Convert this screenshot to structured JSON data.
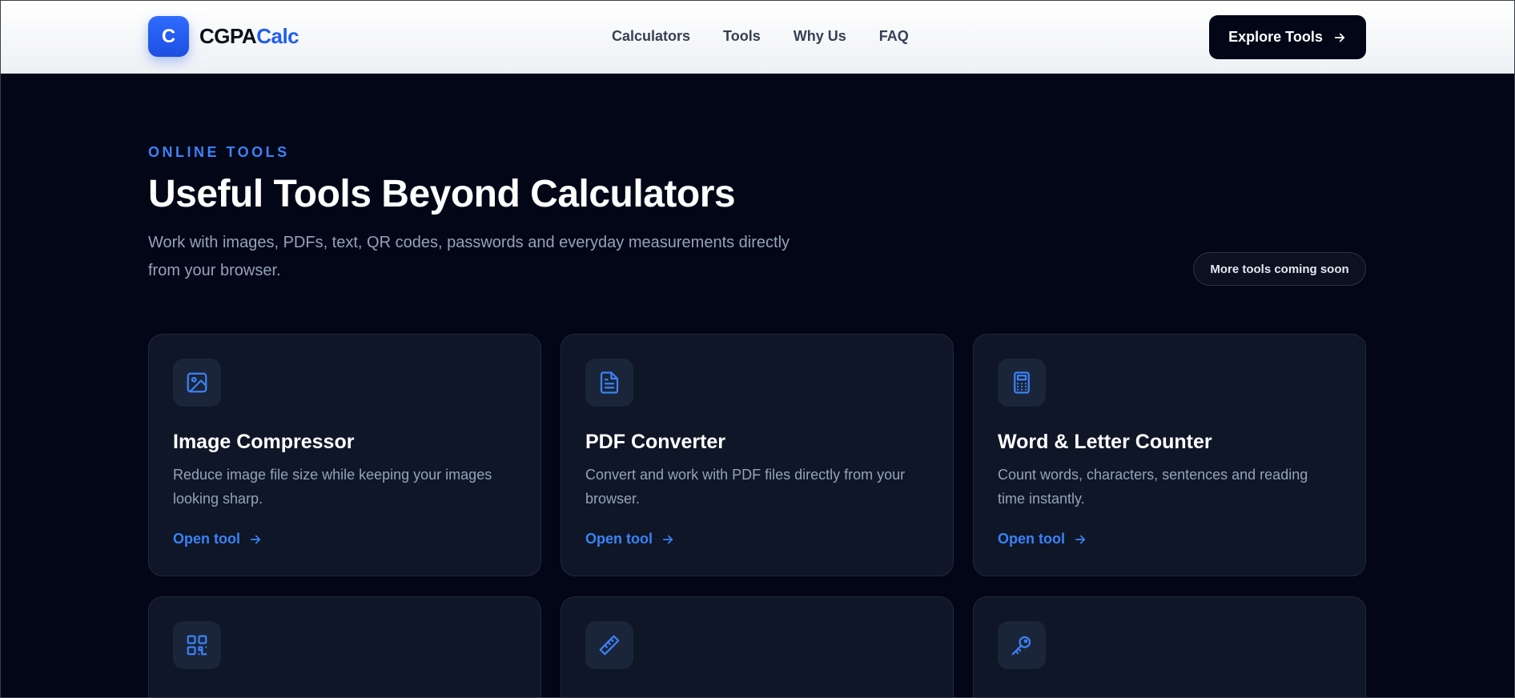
{
  "header": {
    "logo_letter": "C",
    "logo_part1": "CGPA",
    "logo_part2": "Calc",
    "nav": [
      "Calculators",
      "Tools",
      "Why Us",
      "FAQ"
    ],
    "cta_label": "Explore Tools"
  },
  "hero": {
    "eyebrow": "ONLINE TOOLS",
    "title": "Useful Tools Beyond Calculators",
    "subtitle": "Work with images, PDFs, text, QR codes, passwords and everyday measurements directly from your browser.",
    "badge": "More tools coming soon"
  },
  "tools": [
    {
      "icon": "image-icon",
      "title": "Image Compressor",
      "desc": "Reduce image file size while keeping your images looking sharp.",
      "link": "Open tool"
    },
    {
      "icon": "document-icon",
      "title": "PDF Converter",
      "desc": "Convert and work with PDF files directly from your browser.",
      "link": "Open tool"
    },
    {
      "icon": "calculator-icon",
      "title": "Word & Letter Counter",
      "desc": "Count words, characters, sentences and reading time instantly.",
      "link": "Open tool"
    },
    {
      "icon": "qr-code-icon"
    },
    {
      "icon": "ruler-icon"
    },
    {
      "icon": "key-icon"
    }
  ],
  "colors": {
    "accent": "#3b82f6",
    "brand": "#1f5df0",
    "background": "#020617",
    "card": "#0e1627"
  }
}
